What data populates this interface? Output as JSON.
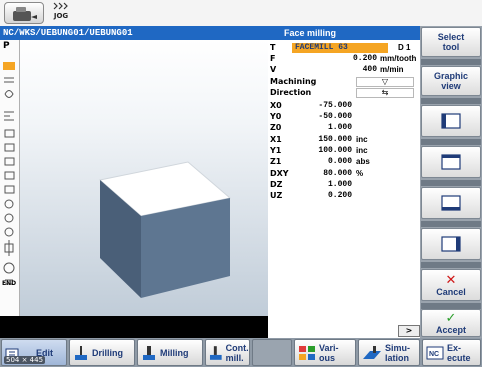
{
  "header": {
    "mode": "JOG",
    "path": "NC/WKS/UEBUNG01/UEBUNG01",
    "title": "Face milling"
  },
  "left_strip": {
    "first_label": "P",
    "end_label": "END"
  },
  "params": {
    "tool_label": "T",
    "tool_value": "FACEMILL 63",
    "tool_d": "D 1",
    "f_label": "F",
    "f_value": "0.200",
    "f_unit": "mm/tooth",
    "v_label": "V",
    "v_value": "400",
    "v_unit": "m/min",
    "machining_label": "Machining",
    "machining_value": "▽",
    "direction_label": "Direction",
    "direction_value": "⇆",
    "rows": [
      {
        "label": "X0",
        "value": "-75.000",
        "unit": ""
      },
      {
        "label": "Y0",
        "value": "-50.000",
        "unit": ""
      },
      {
        "label": "Z0",
        "value": "1.000",
        "unit": ""
      },
      {
        "label": "X1",
        "value": "150.000",
        "unit": "inc"
      },
      {
        "label": "Y1",
        "value": "100.000",
        "unit": "inc"
      },
      {
        "label": "Z1",
        "value": "0.000",
        "unit": "abs"
      },
      {
        "label": "DXY",
        "value": "80.000",
        "unit": "%"
      },
      {
        "label": "DZ",
        "value": "1.000",
        "unit": ""
      },
      {
        "label": "UZ",
        "value": "0.200",
        "unit": ""
      }
    ]
  },
  "softkeys": {
    "select_tool": "Select tool",
    "graphic_view": "Graphic view",
    "cancel": "Cancel",
    "accept": "Accept",
    "more": ">"
  },
  "bottom": {
    "edit": "Edit",
    "resolution": "504 × 445",
    "drilling": "Drilling",
    "milling": "Milling",
    "cont_mill": "Cont. mill.",
    "various": "Vari- ous",
    "simulation": "Simu- lation",
    "execute": "Ex- ecute"
  },
  "colors": {
    "title_blue": "#1f68c3",
    "highlight_orange": "#f5a523",
    "cancel_red": "#d01818",
    "accept_green": "#2a9d2a"
  }
}
